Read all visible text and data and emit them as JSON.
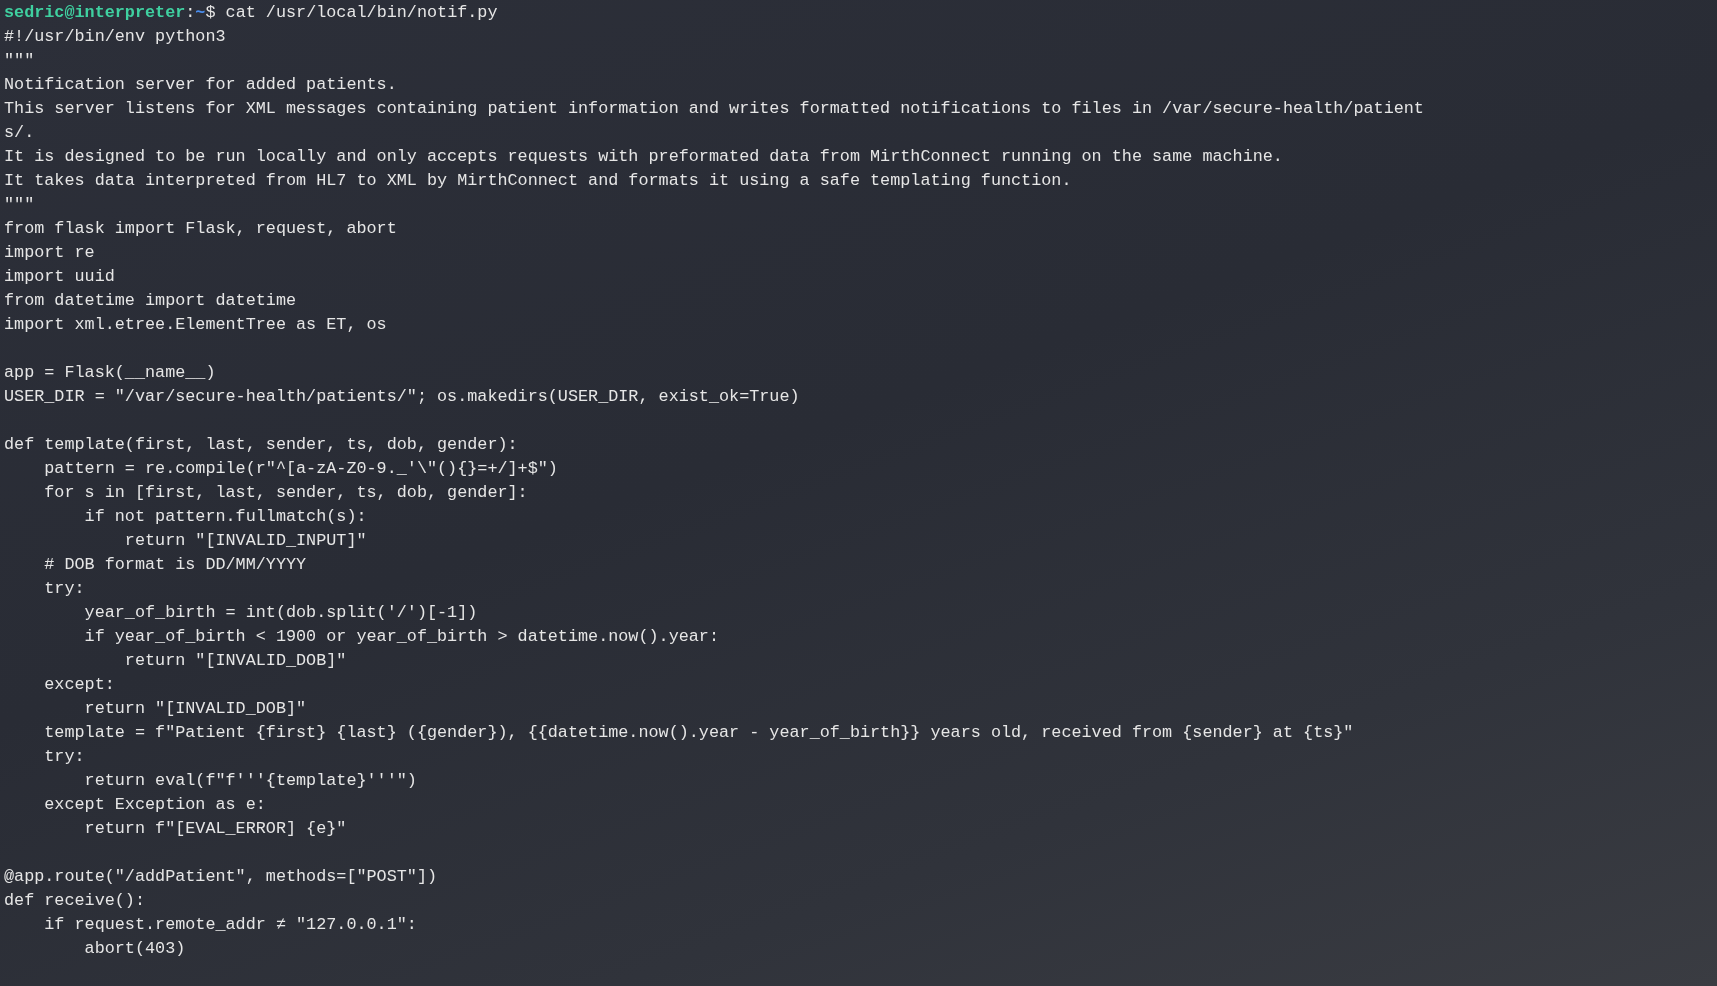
{
  "prompt": {
    "user_host": "sedric@interpreter",
    "separator": ":",
    "cwd": "~",
    "symbol": "$",
    "command": " cat /usr/local/bin/notif.py"
  },
  "output_lines": [
    {
      "kind": "text",
      "text": "#!/usr/bin/env python3"
    },
    {
      "kind": "text",
      "text": "\"\"\""
    },
    {
      "kind": "text",
      "text": "Notification server for added patients."
    },
    {
      "kind": "text",
      "text": "This server listens for XML messages containing patient information and writes formatted notifications to files in /var/secure-health/patient"
    },
    {
      "kind": "text",
      "text": "s/."
    },
    {
      "kind": "text",
      "text": "It is designed to be run locally and only accepts requests with preformated data from MirthConnect running on the same machine."
    },
    {
      "kind": "text",
      "text": "It takes data interpreted from HL7 to XML by MirthConnect and formats it using a safe templating function."
    },
    {
      "kind": "text",
      "text": "\"\"\""
    },
    {
      "kind": "text",
      "text": "from flask import Flask, request, abort"
    },
    {
      "kind": "text",
      "text": "import re"
    },
    {
      "kind": "text",
      "text": "import uuid"
    },
    {
      "kind": "text",
      "text": "from datetime import datetime"
    },
    {
      "kind": "text",
      "text": "import xml.etree.ElementTree as ET, os"
    },
    {
      "kind": "blank"
    },
    {
      "kind": "text",
      "text": "app = Flask(__name__)"
    },
    {
      "kind": "text",
      "text": "USER_DIR = \"/var/secure-health/patients/\"; os.makedirs(USER_DIR, exist_ok=True)"
    },
    {
      "kind": "blank"
    },
    {
      "kind": "text",
      "text": "def template(first, last, sender, ts, dob, gender):"
    },
    {
      "kind": "text",
      "text": "    pattern = re.compile(r\"^[a-zA-Z0-9._'\\\"(){}=+/]+$\")"
    },
    {
      "kind": "text",
      "text": "    for s in [first, last, sender, ts, dob, gender]:"
    },
    {
      "kind": "text",
      "text": "        if not pattern.fullmatch(s):"
    },
    {
      "kind": "text",
      "text": "            return \"[INVALID_INPUT]\""
    },
    {
      "kind": "text",
      "text": "    # DOB format is DD/MM/YYYY"
    },
    {
      "kind": "text",
      "text": "    try:"
    },
    {
      "kind": "text",
      "text": "        year_of_birth = int(dob.split('/')[-1])"
    },
    {
      "kind": "text",
      "text": "        if year_of_birth < 1900 or year_of_birth > datetime.now().year:"
    },
    {
      "kind": "text",
      "text": "            return \"[INVALID_DOB]\""
    },
    {
      "kind": "text",
      "text": "    except:"
    },
    {
      "kind": "text",
      "text": "        return \"[INVALID_DOB]\""
    },
    {
      "kind": "text",
      "text": "    template = f\"Patient {first} {last} ({gender}), {{datetime.now().year - year_of_birth}} years old, received from {sender} at {ts}\""
    },
    {
      "kind": "text",
      "text": "    try:"
    },
    {
      "kind": "text",
      "text": "        return eval(f\"f'''{template}'''\")"
    },
    {
      "kind": "text",
      "text": "    except Exception as e:"
    },
    {
      "kind": "text",
      "text": "        return f\"[EVAL_ERROR] {e}\""
    },
    {
      "kind": "blank"
    },
    {
      "kind": "text",
      "text": "@app.route(\"/addPatient\", methods=[\"POST\"])"
    },
    {
      "kind": "text",
      "text": "def receive():"
    },
    {
      "kind": "text",
      "text": "    if request.remote_addr ≠ \"127.0.0.1\":"
    },
    {
      "kind": "text",
      "text": "        abort(403)"
    }
  ]
}
